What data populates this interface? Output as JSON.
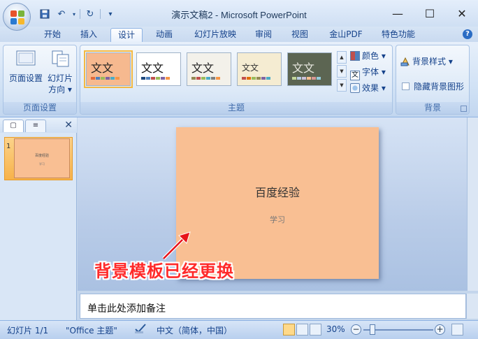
{
  "window": {
    "title": "演示文稿2 - Microsoft PowerPoint",
    "minimize_label": "—",
    "maximize_label": "☐",
    "close_label": "✕"
  },
  "qat": {
    "more_label": "▾"
  },
  "tabs": [
    {
      "label": "开始"
    },
    {
      "label": "插入"
    },
    {
      "label": "设计"
    },
    {
      "label": "动画"
    },
    {
      "label": "幻灯片放映"
    },
    {
      "label": "审阅"
    },
    {
      "label": "视图"
    },
    {
      "label": "金山PDF"
    },
    {
      "label": "特色功能"
    }
  ],
  "active_tab": "设计",
  "ribbon": {
    "page_setup": {
      "group_label": "页面设置",
      "page_setup_button": "页面设置",
      "orientation_line1": "幻灯片",
      "orientation_line2": "方向 ▾"
    },
    "themes": {
      "group_label": "主题",
      "items": [
        {
          "text": "文文",
          "bg": "#f6b98f",
          "text_color": "#222"
        },
        {
          "text": "文文",
          "bg": "#ffffff",
          "text_color": "#111"
        },
        {
          "text": "文文",
          "bg": "#f3f1ea",
          "text_color": "#222"
        },
        {
          "text": "文文",
          "bg": "#f5ecd2",
          "text_color": "#333"
        },
        {
          "text": "文文",
          "bg": "#5c6552",
          "text_color": "#e8e8e0"
        }
      ],
      "colors_label": "颜色 ▾",
      "fonts_label": "字体 ▾",
      "effects_label": "效果 ▾"
    },
    "background": {
      "group_label": "背景",
      "styles_label": "背景样式 ▾",
      "hide_graphics_label": "隐藏背景图形"
    }
  },
  "left_panel": {
    "tab_slides": "▢",
    "tab_outline": "≡",
    "close_label": "✕",
    "slide_number": "1",
    "thumb_title": "百度经验",
    "thumb_subtitle": "学习"
  },
  "slide": {
    "title": "百度经验",
    "subtitle": "学习",
    "background_color": "#f9bf93"
  },
  "annotation": "背景模板已经更换",
  "notes_placeholder": "单击此处添加备注",
  "status": {
    "slide_info": "幻灯片 1/1",
    "theme_name": "\"Office 主题\"",
    "language": "中文（简体，中国）",
    "zoom": "30%",
    "zoom_minus": "−",
    "zoom_plus": "+"
  }
}
